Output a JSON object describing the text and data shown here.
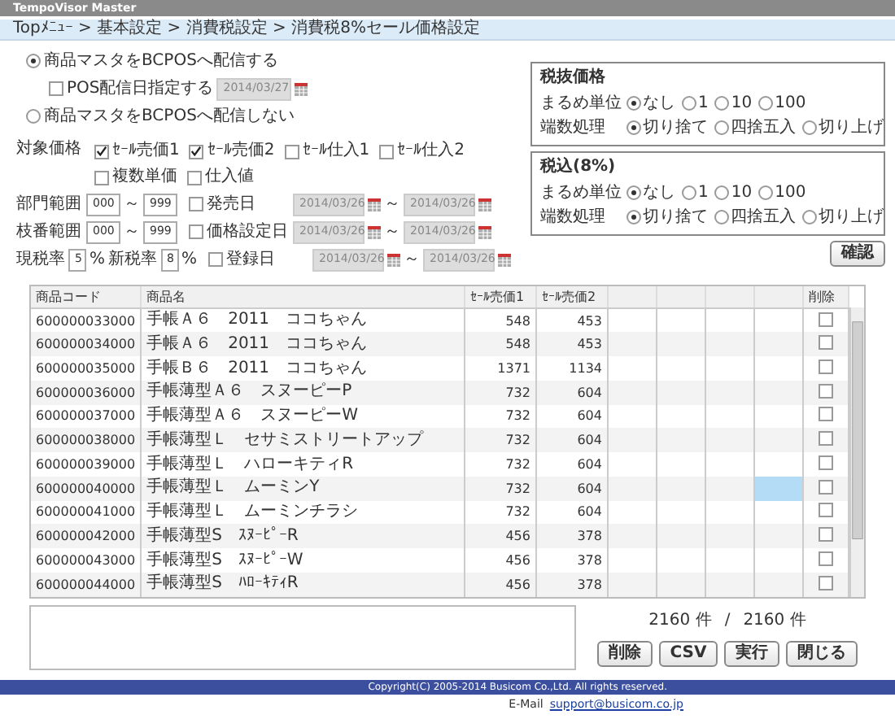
{
  "app_title": "TempoVisor Master",
  "breadcrumb": "Topﾒﾆｭｰ > 基本設定 > 消費税設定 > 消費税8%セール価格設定",
  "distribution": {
    "options": [
      {
        "label": "商品マスタをBCPOSへ配信する",
        "selected": true
      },
      {
        "label": "商品マスタをBCPOSへ配信しない",
        "selected": false
      }
    ],
    "date_option": {
      "label": "POS配信日指定する",
      "checked": false,
      "value": "2014/03/27"
    }
  },
  "target_prices": {
    "label": "対象価格",
    "options": [
      {
        "label": "ｾｰﾙ売価1",
        "checked": true
      },
      {
        "label": "ｾｰﾙ売価2",
        "checked": true
      },
      {
        "label": "ｾｰﾙ仕入1",
        "checked": false
      },
      {
        "label": "ｾｰﾙ仕入2",
        "checked": false
      },
      {
        "label": "複数単価",
        "checked": false
      },
      {
        "label": "仕入値",
        "checked": false
      }
    ]
  },
  "ranges": [
    {
      "label": "部門範囲",
      "from": "000",
      "separator": "～",
      "to": "999"
    },
    {
      "label": "枝番範囲",
      "from": "000",
      "separator": "～",
      "to": "999"
    }
  ],
  "tax_rates": {
    "current_label": "現税率",
    "current": "5",
    "current_unit": "%",
    "new_label": "新税率",
    "new": "8",
    "new_unit": "%"
  },
  "date_filters": [
    {
      "label": "発売日",
      "checked": false,
      "from": "2014/03/26",
      "separator": "～",
      "to": "2014/03/26"
    },
    {
      "label": "価格設定日",
      "checked": false,
      "from": "2014/03/26",
      "separator": "～",
      "to": "2014/03/26"
    },
    {
      "label": "登録日",
      "checked": false,
      "from": "2014/03/26",
      "separator": "～",
      "to": "2014/03/26"
    }
  ],
  "rounding_boxes": [
    {
      "title": "税抜価格",
      "unit_label": "まるめ単位",
      "units": [
        {
          "label": "なし",
          "selected": true
        },
        {
          "label": "1",
          "selected": false
        },
        {
          "label": "10",
          "selected": false
        },
        {
          "label": "100",
          "selected": false
        }
      ],
      "fraction_label": "端数処理",
      "fractions": [
        {
          "label": "切り捨て",
          "selected": true
        },
        {
          "label": "四捨五入",
          "selected": false
        },
        {
          "label": "切り上げ",
          "selected": false
        }
      ]
    },
    {
      "title": "税込(8%)",
      "unit_label": "まるめ単位",
      "units": [
        {
          "label": "なし",
          "selected": true
        },
        {
          "label": "1",
          "selected": false
        },
        {
          "label": "10",
          "selected": false
        },
        {
          "label": "100",
          "selected": false
        }
      ],
      "fraction_label": "端数処理",
      "fractions": [
        {
          "label": "切り捨て",
          "selected": true
        },
        {
          "label": "四捨五入",
          "selected": false
        },
        {
          "label": "切り上げ",
          "selected": false
        }
      ]
    }
  ],
  "confirm_button": "確認",
  "table": {
    "columns": [
      "商品コード",
      "商品名",
      "ｾｰﾙ売価1",
      "ｾｰﾙ売価2",
      "削除"
    ],
    "rows": [
      {
        "code": "600000033000",
        "name": "手帳Ａ６　2011　ココちゃん",
        "price_1": "548",
        "price_2": "453",
        "selected": false,
        "delete": false
      },
      {
        "code": "600000034000",
        "name": "手帳Ａ６　2011　ココちゃん",
        "price_1": "548",
        "price_2": "453",
        "selected": false,
        "delete": false
      },
      {
        "code": "600000035000",
        "name": "手帳Ｂ６　2011　ココちゃん",
        "price_1": "1371",
        "price_2": "1134",
        "selected": false,
        "delete": false
      },
      {
        "code": "600000036000",
        "name": "手帳薄型Ａ６　スヌーピーP",
        "price_1": "732",
        "price_2": "604",
        "selected": false,
        "delete": false
      },
      {
        "code": "600000037000",
        "name": "手帳薄型Ａ６　スヌーピーW",
        "price_1": "732",
        "price_2": "604",
        "selected": false,
        "delete": false
      },
      {
        "code": "600000038000",
        "name": "手帳薄型Ｌ　セサミストリートアップ",
        "price_1": "732",
        "price_2": "604",
        "selected": false,
        "delete": false
      },
      {
        "code": "600000039000",
        "name": "手帳薄型Ｌ　ハローキティR",
        "price_1": "732",
        "price_2": "604",
        "selected": false,
        "delete": false
      },
      {
        "code": "600000040000",
        "name": "手帳薄型Ｌ　ムーミンY",
        "price_1": "732",
        "price_2": "604",
        "selected": true,
        "delete": false
      },
      {
        "code": "600000041000",
        "name": "手帳薄型Ｌ　ムーミンチラシ",
        "price_1": "732",
        "price_2": "604",
        "selected": false,
        "delete": false
      },
      {
        "code": "600000042000",
        "name": "手帳薄型S　ｽﾇｰﾋﾟｰR",
        "price_1": "456",
        "price_2": "378",
        "selected": false,
        "delete": false
      },
      {
        "code": "600000043000",
        "name": "手帳薄型S　ｽﾇｰﾋﾟｰW",
        "price_1": "456",
        "price_2": "378",
        "selected": false,
        "delete": false
      },
      {
        "code": "600000044000",
        "name": "手帳薄型S　ﾊﾛｰｷﾃｨR",
        "price_1": "456",
        "price_2": "378",
        "selected": false,
        "delete": false
      }
    ]
  },
  "count": {
    "shown": "2160 件",
    "separator": "/",
    "total": "2160 件"
  },
  "buttons": [
    "削除",
    "CSV",
    "実行",
    "閉じる"
  ],
  "footer": {
    "copyright": "Copyright(C) 2005-2014 Busicom Co.,Ltd. All rights reserved.",
    "email_label": "E-Mail",
    "email": "support@busicom.co.jp"
  }
}
